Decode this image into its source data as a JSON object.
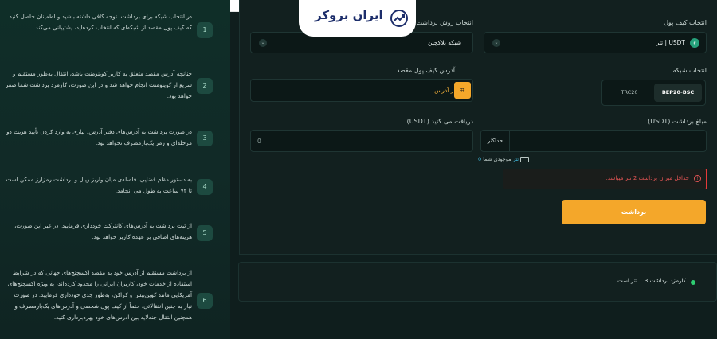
{
  "header": {
    "logo_text": "ایران بروکر"
  },
  "guide": {
    "items": [
      {
        "num": "1",
        "text": "در انتخاب شبکه برای برداشت، توجه کافی داشته باشید و اطمینان حاصل کنید که کیف پول مقصد از شبکه‌ای که انتخاب کرده‌اید، پشتیبانی می‌کند."
      },
      {
        "num": "2",
        "text": "چنانچه آدرس مقصد متعلق به کاربر کوینومنت باشد، انتقال به‌طور مستقیم و سریع از کوینومنت انجام خواهد شد و در این صورت، کارمزد برداشت شما صفر خواهد بود."
      },
      {
        "num": "3",
        "text": "در صورت برداشت به آدرس‌های دفتر آدرس، نیازی به وارد کردن تأیید هویت دو مرحله‌ای و رمز یک‌بارمصرف نخواهد بود."
      },
      {
        "num": "4",
        "text": "به دستور مقام قضایی، فاصله‌ی میان واریز ریال و برداشت رمزارز ممکن است تا ۷۲ ساعت به طول می انجامد."
      },
      {
        "num": "5",
        "text": "از ثبت برداشت به آدرس‌های کانترکت خودداری فرمایید. در غیر این صورت، هزینه‌های اضافی بر عهده کاربر خواهد بود."
      },
      {
        "num": "6",
        "text": "از برداشت مستقیم از آدرس خود به مقصد اکسچنج‌های جهانی که در شرایط استفاده از خدمات خود، کاربران ایرانی را محدود کرده‌اند، به ویژه اکسچنج‌های آمریکایی مانند کوین‌بیس و کراکن، به‌طور جدی خودداری فرمایید. در صورت نیاز به چنین انتقالاتی، حتماً از کیف پول شخصی و آدرس‌های یک‌بارمصرف و همچنین انتقال چندلایه بین آدرس‌های خود بهره‌برداری کنید."
      }
    ]
  },
  "form": {
    "wallet_label": "انتخاب کیف پول",
    "wallet_value": "USDT | تتر",
    "method_label": "انتخاب روش برداشت",
    "method_value": "شبکه بلاکچین",
    "network_label": "انتخاب شبکه",
    "network_options": [
      "BEP20-BSC",
      "TRC20"
    ],
    "network_selected": "BEP20-BSC",
    "address_label": "آدرس کیف پول مقصد",
    "address_book": "دفتر آدرس",
    "amount_label": "مبلغ برداشت (USDT)",
    "max_label": "حداکثر",
    "receive_label": "دریافت می کنید (USDT)",
    "receive_value": "0",
    "balance_prefix": "موجودی شما",
    "balance_value": "0 تتر",
    "error_text": "حداقل میزان برداشت 2 تتر میباشد.",
    "submit_label": "برداشت"
  },
  "fee": {
    "text": "کارمزد برداشت 1.3 تتر است."
  },
  "colors": {
    "accent": "#f4a72a",
    "error": "#e25454",
    "usdt": "#26a17b",
    "success": "#2ecc71"
  }
}
